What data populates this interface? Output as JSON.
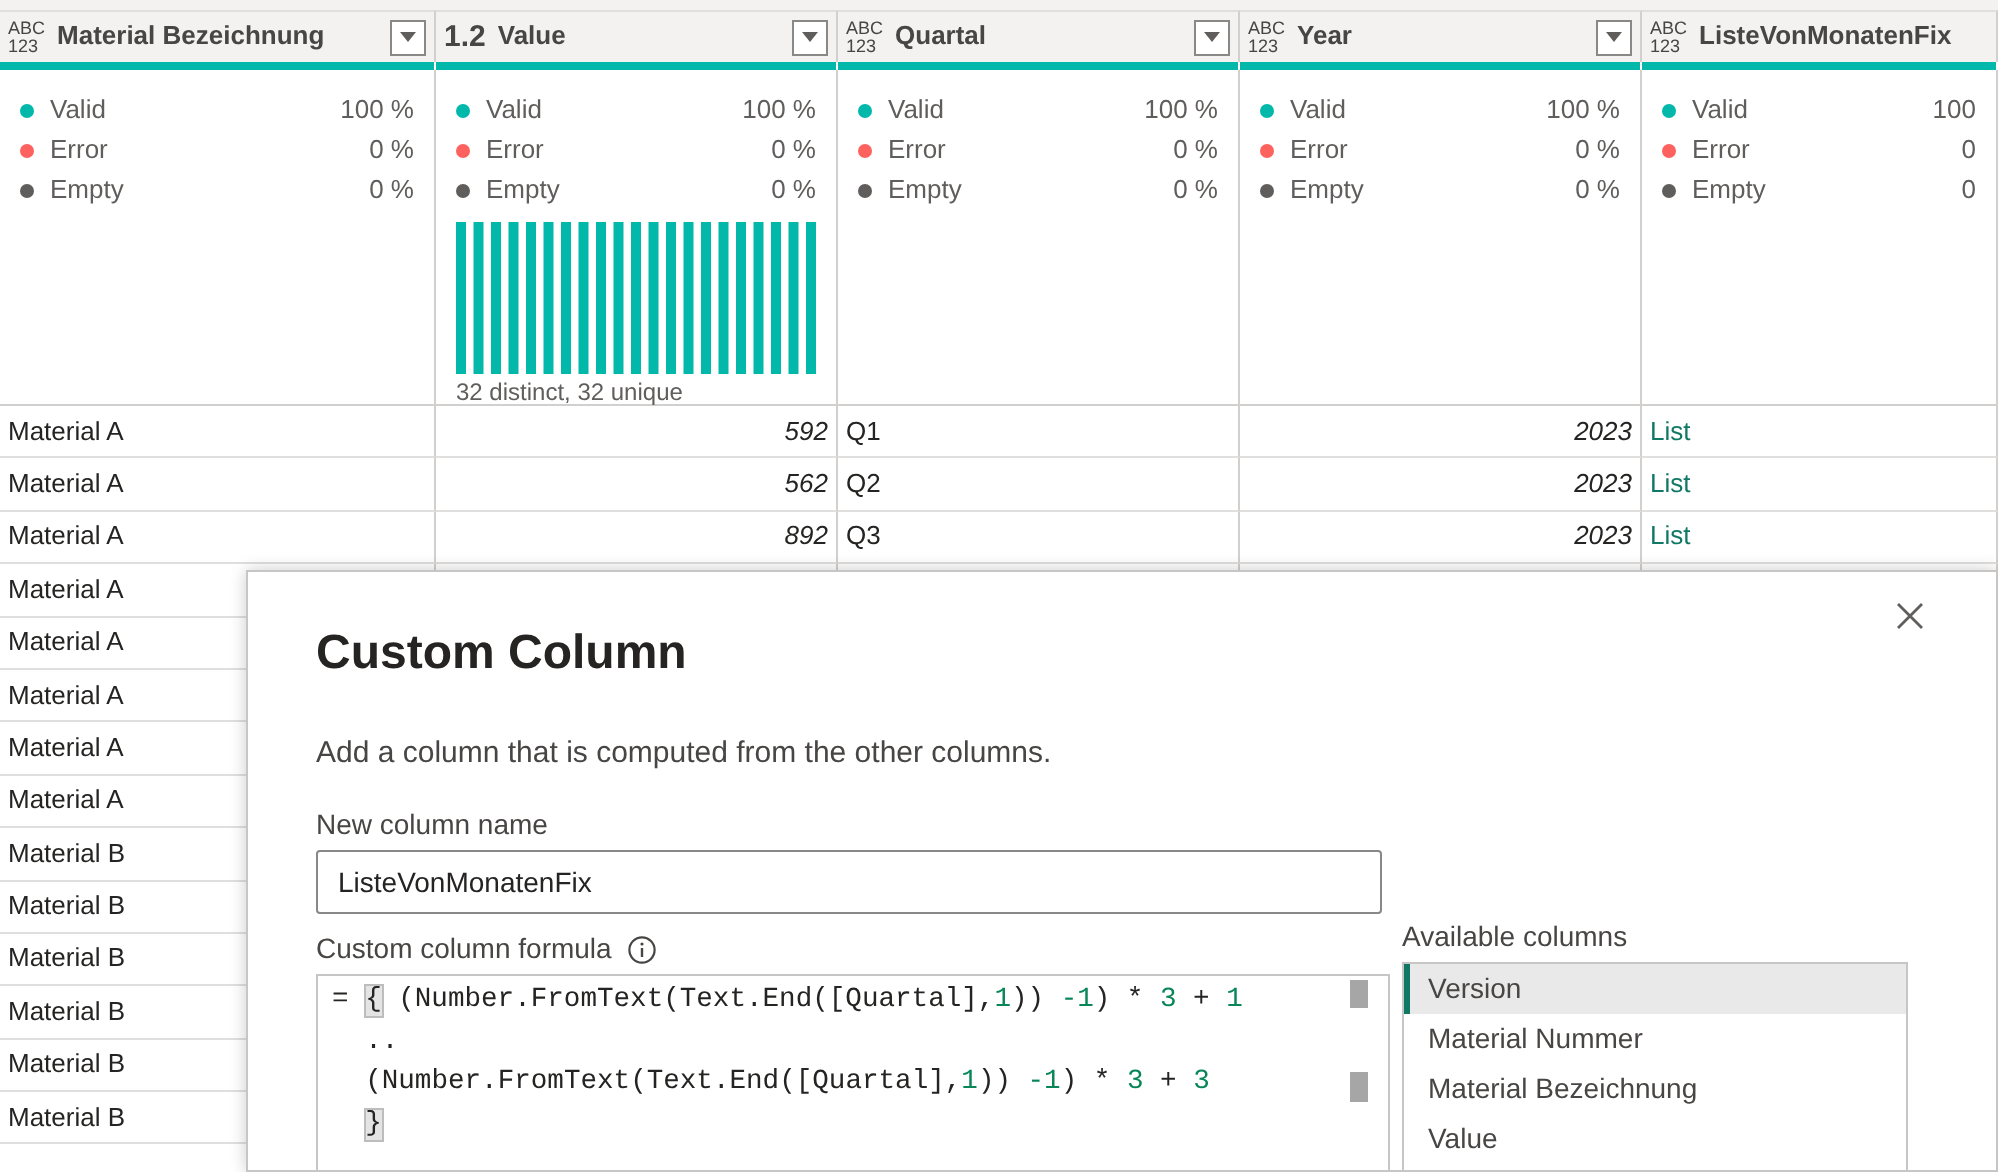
{
  "table": {
    "columns": [
      {
        "title": "Material Bezeichnung",
        "type_icon": [
          "ABC",
          "123"
        ],
        "has_filter": true,
        "kind": "text",
        "profile": {
          "stats": [
            {
              "label": "Valid",
              "value": "100 %",
              "color": "#01b8aa"
            },
            {
              "label": "Error",
              "value": "0 %",
              "color": "#fd625e"
            },
            {
              "label": "Empty",
              "value": "0 %",
              "color": "#605e5c"
            }
          ]
        }
      },
      {
        "title": "Value",
        "type_icon": [
          "1.2"
        ],
        "has_filter": true,
        "kind": "number",
        "profile": {
          "stats": [
            {
              "label": "Valid",
              "value": "100 %",
              "color": "#01b8aa"
            },
            {
              "label": "Error",
              "value": "0 %",
              "color": "#fd625e"
            },
            {
              "label": "Empty",
              "value": "0 %",
              "color": "#605e5c"
            }
          ],
          "histogram_caption": "32 distinct, 32 unique"
        }
      },
      {
        "title": "Quartal",
        "type_icon": [
          "ABC",
          "123"
        ],
        "has_filter": true,
        "kind": "text",
        "profile": {
          "stats": [
            {
              "label": "Valid",
              "value": "100 %",
              "color": "#01b8aa"
            },
            {
              "label": "Error",
              "value": "0 %",
              "color": "#fd625e"
            },
            {
              "label": "Empty",
              "value": "0 %",
              "color": "#605e5c"
            }
          ]
        }
      },
      {
        "title": "Year",
        "type_icon": [
          "ABC",
          "123"
        ],
        "has_filter": true,
        "kind": "number",
        "profile": {
          "stats": [
            {
              "label": "Valid",
              "value": "100 %",
              "color": "#01b8aa"
            },
            {
              "label": "Error",
              "value": "0 %",
              "color": "#fd625e"
            },
            {
              "label": "Empty",
              "value": "0 %",
              "color": "#605e5c"
            }
          ]
        }
      },
      {
        "title": "ListeVonMonatenFix",
        "type_icon": [
          "ABC",
          "123"
        ],
        "has_filter": false,
        "kind": "link",
        "profile": {
          "stats": [
            {
              "label": "Valid",
              "value": "100",
              "color": "#01b8aa"
            },
            {
              "label": "Error",
              "value": "0",
              "color": "#fd625e"
            },
            {
              "label": "Empty",
              "value": "0",
              "color": "#605e5c"
            }
          ]
        }
      }
    ],
    "rows": [
      {
        "cells": [
          "Material A",
          "592",
          "Q1",
          "2023",
          "List"
        ]
      },
      {
        "cells": [
          "Material A",
          "562",
          "Q2",
          "2023",
          "List"
        ]
      },
      {
        "cells": [
          "Material A",
          "892",
          "Q3",
          "2023",
          "List"
        ]
      },
      {
        "cells": [
          "Material A"
        ]
      },
      {
        "cells": [
          "Material A"
        ]
      },
      {
        "cells": [
          "Material A"
        ]
      },
      {
        "cells": [
          "Material A"
        ]
      },
      {
        "cells": [
          "Material A"
        ]
      },
      {
        "cells": [
          "Material B"
        ]
      },
      {
        "cells": [
          "Material B"
        ]
      },
      {
        "cells": [
          "Material B"
        ]
      },
      {
        "cells": [
          "Material B"
        ]
      },
      {
        "cells": [
          "Material B"
        ]
      },
      {
        "cells": [
          "Material B"
        ]
      }
    ]
  },
  "dialog": {
    "title": "Custom Column",
    "description": "Add a column that is computed from the other columns.",
    "name_label": "New column name",
    "name_value": "ListeVonMonatenFix",
    "formula_label": "Custom column formula",
    "formula_lines": [
      {
        "indented": false,
        "tokens": [
          {
            "text": "= ",
            "kind": "plain"
          },
          {
            "text": "{",
            "kind": "brace"
          },
          {
            "text": " (Number.FromText(Text.End([Quartal],",
            "kind": "plain"
          },
          {
            "text": "1",
            "kind": "number"
          },
          {
            "text": ")) ",
            "kind": "plain"
          },
          {
            "text": "-1",
            "kind": "number"
          },
          {
            "text": ") * ",
            "kind": "plain"
          },
          {
            "text": "3",
            "kind": "number"
          },
          {
            "text": " + ",
            "kind": "plain"
          },
          {
            "text": "1",
            "kind": "number"
          }
        ]
      },
      {
        "indented": true,
        "tokens": [
          {
            "text": "..",
            "kind": "plain"
          }
        ]
      },
      {
        "indented": true,
        "tokens": [
          {
            "text": "(Number.FromText(Text.End([Quartal],",
            "kind": "plain"
          },
          {
            "text": "1",
            "kind": "number"
          },
          {
            "text": ")) ",
            "kind": "plain"
          },
          {
            "text": "-1",
            "kind": "number"
          },
          {
            "text": ") * ",
            "kind": "plain"
          },
          {
            "text": "3",
            "kind": "number"
          },
          {
            "text": " + ",
            "kind": "plain"
          },
          {
            "text": "3",
            "kind": "number"
          }
        ]
      },
      {
        "indented": true,
        "tokens": [
          {
            "text": "}",
            "kind": "brace"
          }
        ]
      }
    ],
    "available_label": "Available columns",
    "available_columns": [
      {
        "label": "Version",
        "selected": true
      },
      {
        "label": "Material Nummer",
        "selected": false
      },
      {
        "label": "Material Bezeichnung",
        "selected": false
      },
      {
        "label": "Value",
        "selected": false
      }
    ]
  }
}
